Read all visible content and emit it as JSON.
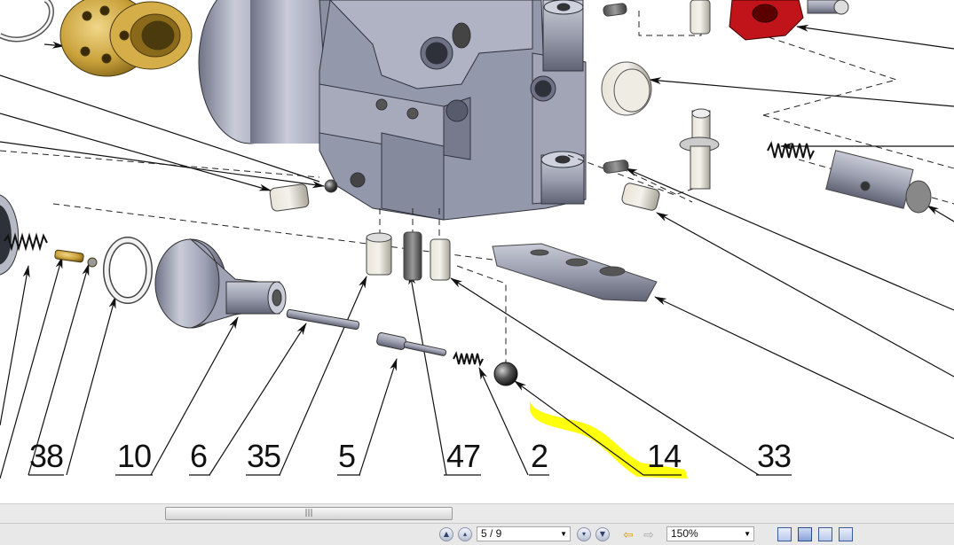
{
  "diagram": {
    "callouts": [
      {
        "id": "38",
        "label": "38"
      },
      {
        "id": "10",
        "label": "10"
      },
      {
        "id": "6",
        "label": "6"
      },
      {
        "id": "35",
        "label": "35"
      },
      {
        "id": "5",
        "label": "5"
      },
      {
        "id": "47",
        "label": "47"
      },
      {
        "id": "2",
        "label": "2"
      },
      {
        "id": "14",
        "label": "14"
      },
      {
        "id": "33",
        "label": "33"
      }
    ],
    "highlight_color": "#ffff00",
    "part_gold": "#c9a13a",
    "part_red": "#c0141a",
    "part_steel": "#a9adbf"
  },
  "scrollbar": {
    "grip": "|||"
  },
  "toolbar": {
    "first_page_icon": "first-page-icon",
    "prev_page_icon": "previous-page-icon",
    "page_value": "5 / 9",
    "next_page_icon": "next-page-icon",
    "last_page_icon": "last-page-icon",
    "back_icon": "back-arrow-icon",
    "forward_icon": "forward-arrow-icon",
    "zoom_value": "150%",
    "view_icons": [
      "single-page-icon",
      "continuous-page-icon",
      "facing-pages-icon",
      "continuous-facing-icon"
    ]
  }
}
